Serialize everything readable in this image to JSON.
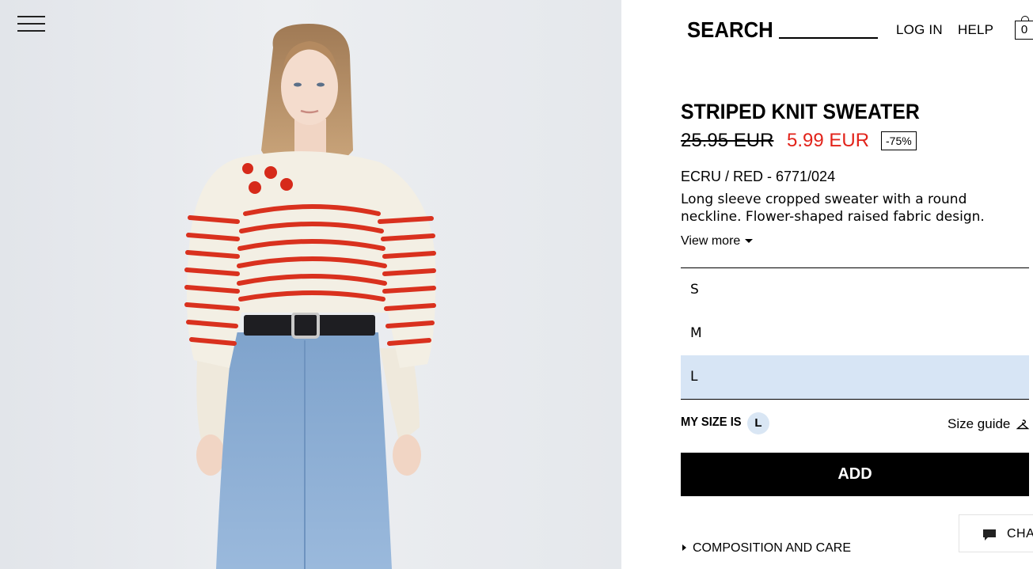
{
  "header": {
    "search_label": "SEARCH",
    "login_label": "LOG IN",
    "help_label": "HELP",
    "cart_count": "0"
  },
  "product": {
    "title": "STRIPED KNIT SWEATER",
    "old_price": "25.95 EUR",
    "new_price": "5.99 EUR",
    "discount": "-75%",
    "color_ref": "ECRU / RED - 6771/024",
    "description": "Long sleeve cropped sweater with a round neckline. Flower-shaped raised fabric design.",
    "view_more_label": "View more"
  },
  "sizes": {
    "items": [
      {
        "label": "S",
        "selected": false
      },
      {
        "label": "M",
        "selected": false
      },
      {
        "label": "L",
        "selected": true
      }
    ],
    "my_size_label": "MY SIZE IS",
    "my_size_value": "L",
    "size_guide_label": "Size guide"
  },
  "actions": {
    "add_label": "ADD",
    "composition_label": "COMPOSITION AND CARE",
    "chat_label": "CHA"
  },
  "colors": {
    "price_accent": "#e2231a",
    "selected_size_bg": "#d7e5f5",
    "button_bg": "#000000"
  },
  "icons": {
    "menu": "hamburger-icon",
    "cart": "shopping-bag-icon",
    "size_guide": "hanger-icon",
    "chat": "chat-bubble-icon"
  }
}
